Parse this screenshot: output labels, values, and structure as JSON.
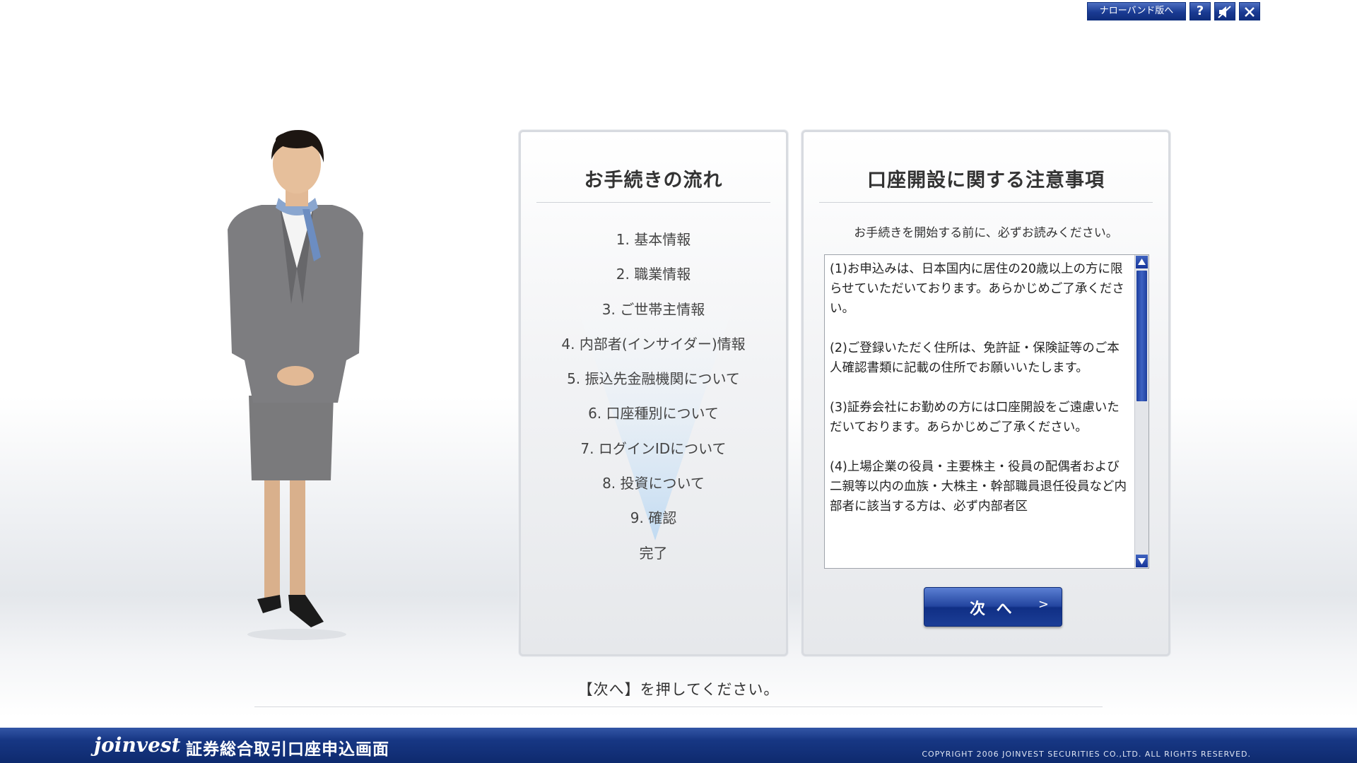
{
  "top_tools": {
    "narrowband_label": "ナローバンド版へ",
    "help_label": "?",
    "mute_icon": "speaker-off-icon",
    "close_icon": "close-icon"
  },
  "flow": {
    "title": "お手続きの流れ",
    "steps": [
      "1. 基本情報",
      "2. 職業情報",
      "3. ご世帯主情報",
      "4. 内部者(インサイダー)情報",
      "5. 振込先金融機関について",
      "6. 口座種別について",
      "7. ログインIDについて",
      "8. 投資について",
      "9. 確認",
      "完了"
    ]
  },
  "notice": {
    "title": "口座開設に関する注意事項",
    "intro": "お手続きを開始する前に、必ずお読みください。",
    "items": [
      "(1)お申込みは、日本国内に居住の20歳以上の方に限らせていただいております。あらかじめご了承ください。",
      "(2)ご登録いただく住所は、免許証・保険証等のご本人確認書類に記載の住所でお願いいたします。",
      "(3)証券会社にお勤めの方には口座開設をご遠慮いただいております。あらかじめご了承ください。",
      "(4)上場企業の役員・主要株主・役員の配偶者および二親等以内の血族・大株主・幹部職員退任役員など内部者に該当する方は、必ず内部者区"
    ],
    "next_label": "次 へ",
    "next_chevron": ">"
  },
  "instruction": "【次へ】を押してください。",
  "footer": {
    "brand": "joinvest",
    "title": "証券総合取引口座申込画面",
    "copyright": "COPYRIGHT 2006 JOINVEST SECURITIES CO.,LTD. ALL RIGHTS RESERVED."
  },
  "colors": {
    "accent_navy": "#1a3b93",
    "footer_navy": "#0e2a6e"
  }
}
